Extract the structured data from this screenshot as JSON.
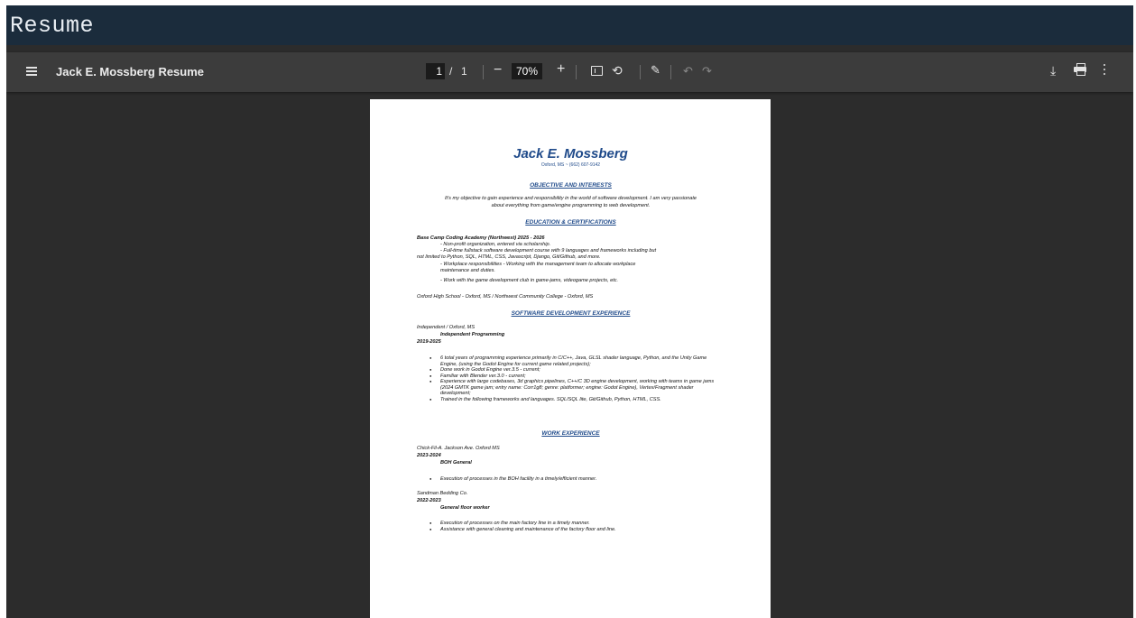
{
  "site": {
    "title": "Resume"
  },
  "toolbar": {
    "doc_title": "Jack E. Mossberg Resume",
    "page_current": "1",
    "page_separator": "/",
    "page_total": "1",
    "zoom_out_label": "−",
    "zoom_level": "70%",
    "zoom_in_label": "+",
    "icons": [
      "menu-icon",
      "fit-page-icon",
      "rotate-icon",
      "annotate-icon",
      "undo-icon",
      "redo-icon",
      "download-icon",
      "print-icon",
      "more-options-icon"
    ]
  },
  "resume": {
    "name": "Jack E. Mossberg",
    "contact": "Oxford, MS ~ (662) 607-9142",
    "objective_heading": "OBJECTIVE AND INTERESTS",
    "objective_text": "It's my objective to gain experience and responsibility in the world of software development. I am very passionate about everything from game/engine programming to web development.",
    "education_heading": "EDUCATION & CERTIFICATIONS",
    "edu_school": "Base Camp Coding Academy (Northwest) 2025 - 2026",
    "edu_lines": [
      "- Non-profit organization, entered via scholarship.",
      "- Full-time fullstack software development course with 9 languages and frameworks including but",
      "not limited to Python, SQL, HTML, CSS, Javascript, Django, Git/Github, and more.",
      "- Workplace responsibilities - Working with the management team to allocate workplace",
      "maintenance and duties.",
      "- Work with the game development club in game-jams, videogame projects, etc."
    ],
    "edu_other": "Oxford High School - Oxford, MS / Northwest Community College - Oxford, MS",
    "software_heading": "SOFTWARE DEVELOPMENT EXPERIENCE",
    "sw_location": "Independent / Oxford, MS",
    "sw_title": "Independent Programming",
    "sw_years": "2019-2025",
    "sw_bullets": [
      "6 total years of programming experience primarily in C/C++, Java, GLSL shader language, Python, and the Unity Game Engine, (using the Godot Engine for current game related projects);",
      "Done work in Godot Engine ver.3.5 - current;",
      "Familiar with Blender ver.3.0 - current;",
      "Experience with large codebases, 3d graphics pipelines, C++/C 3D engine development, working with teams in game jams (2024 GMTK game jam; entry name: Corr1g8; genre: platformer; engine: Godot Engine), Vertex/Fragment shader development;",
      "Trained in the following frameworks and languages. SQL/SQL lite, Git/Github, Python, HTML, CSS."
    ],
    "work_heading": "WORK EXPERIENCE",
    "job1_place": "Chick-Fil-A. Jackson Ave. Oxford MS",
    "job1_years": "2023-2024",
    "job1_title": "BOH General",
    "job1_bullets": [
      "Execution of processes in the BOH facility in a timely/efficient manner."
    ],
    "job2_place": "Sandman Bedding Co.",
    "job2_years": "2022-2023",
    "job2_title": "General floor worker",
    "job2_bullets": [
      "Execution of processes on the main factory line in a timely manner.",
      "Assistance with general cleaning and maintenance of the factory floor and line."
    ]
  }
}
